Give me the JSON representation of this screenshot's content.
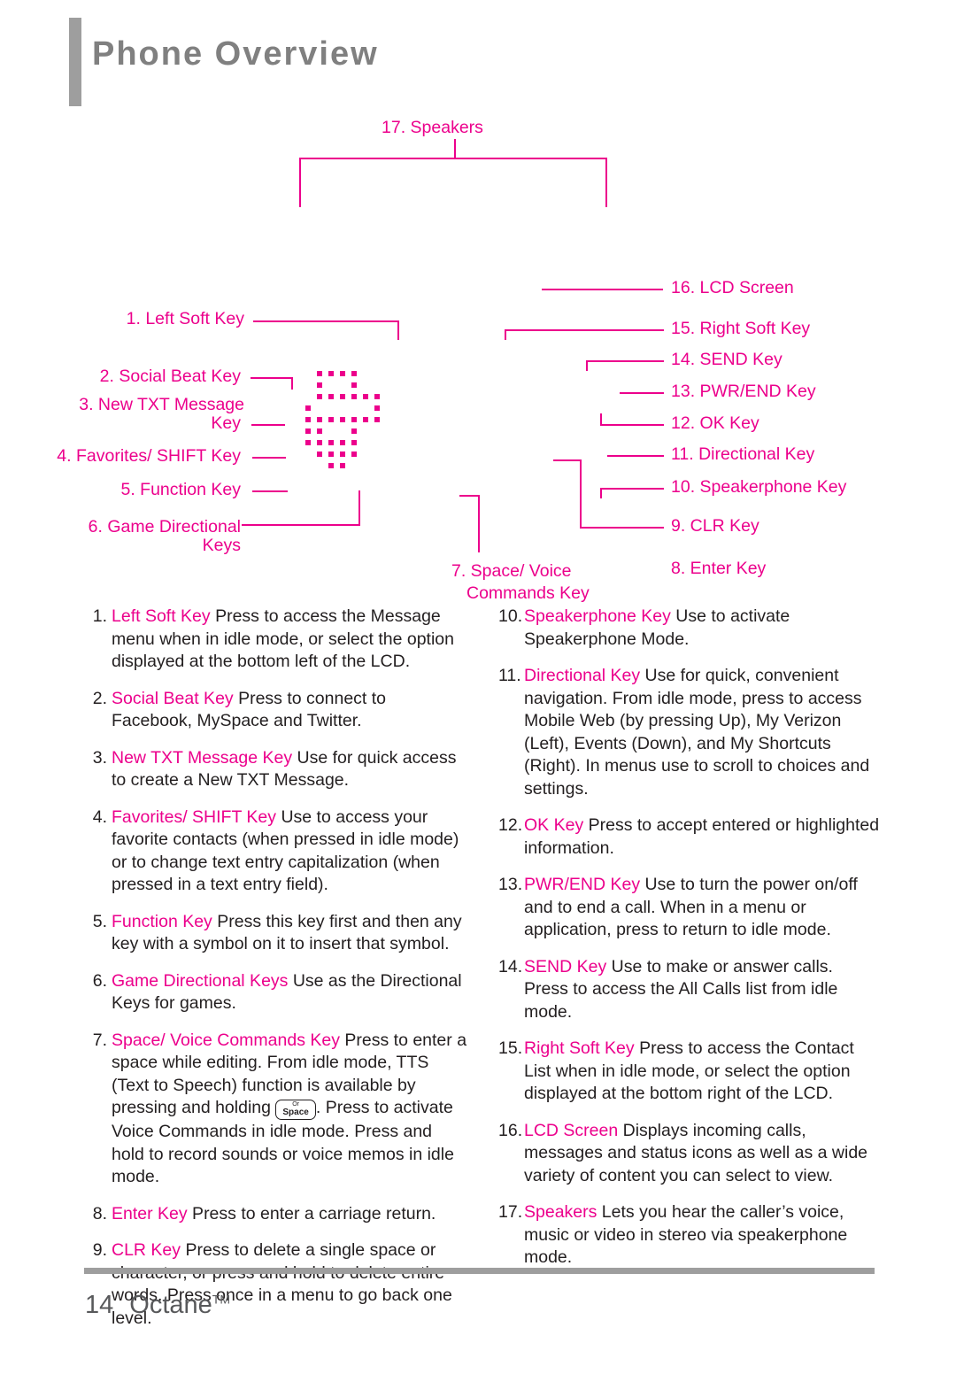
{
  "header": {
    "title": "Phone Overview"
  },
  "diagram": {
    "callouts": [
      {
        "id": "17",
        "label": "17. Speakers"
      },
      {
        "id": "16",
        "label": "16. LCD Screen"
      },
      {
        "id": "15",
        "label": "15. Right Soft Key"
      },
      {
        "id": "14",
        "label": "14. SEND Key"
      },
      {
        "id": "13",
        "label": "13. PWR/END Key"
      },
      {
        "id": "12",
        "label": "12. OK Key"
      },
      {
        "id": "11",
        "label": "11. Directional Key"
      },
      {
        "id": "10",
        "label": "10. Speakerphone Key"
      },
      {
        "id": "9",
        "label": "9. CLR Key"
      },
      {
        "id": "8",
        "label": "8. Enter Key"
      },
      {
        "id": "7a",
        "label": "7. Space/ Voice"
      },
      {
        "id": "7b",
        "label": "Commands Key"
      },
      {
        "id": "1",
        "label": "1. Left Soft Key"
      },
      {
        "id": "2",
        "label": "2. Social Beat Key"
      },
      {
        "id": "3a",
        "label": "3. New TXT Message"
      },
      {
        "id": "3b",
        "label": "Key"
      },
      {
        "id": "4",
        "label": "4. Favorites/ SHIFT Key"
      },
      {
        "id": "5",
        "label": "5. Function Key"
      },
      {
        "id": "6a",
        "label": "6. Game Directional"
      },
      {
        "id": "6b",
        "label": "Keys"
      }
    ]
  },
  "left_column": [
    {
      "num": "1.",
      "term": "Left Soft Key",
      "text": " Press to access the Message menu when in idle mode, or select the option displayed at the bottom left of the LCD."
    },
    {
      "num": "2.",
      "term": "Social Beat Key",
      "text": " Press to connect to Facebook, MySpace and Twitter."
    },
    {
      "num": "3.",
      "term": "New TXT Message Key",
      "text": "  Use for quick access to create a New TXT Message."
    },
    {
      "num": "4.",
      "term": "Favorites/ SHIFT Key",
      "text": " Use to access your favorite contacts (when pressed in idle mode) or to change text entry capitalization (when pressed in a text entry field)."
    },
    {
      "num": "5.",
      "term": "Function Key",
      "text": " Press this key first and then any key with a symbol on it to insert that symbol."
    },
    {
      "num": "6.",
      "term": "Game Directional Keys",
      "text": " Use as the Directional Keys for games."
    },
    {
      "num": "7.",
      "term": "Space/ Voice Commands Key",
      "text_before": " Press to enter a space while editing. From idle mode, TTS (Text to Speech) function is available by pressing and holding ",
      "glyph_top": "Or",
      "glyph_main": "Space",
      "text_after": ". Press to activate Voice Commands in idle mode. Press and hold to record sounds or voice memos in idle mode."
    },
    {
      "num": "8.",
      "term": "Enter Key",
      "text": " Press to enter a carriage return."
    },
    {
      "num": "9.",
      "term": "CLR Key",
      "text": " Press to delete a single space or character, or press and hold to delete entire words. Press once in a menu to go back one level."
    }
  ],
  "right_column": [
    {
      "num": "10.",
      "term": "Speakerphone Key",
      "text": " Use to activate Speakerphone Mode."
    },
    {
      "num": "11.",
      "term": "Directional Key",
      "text": " Use for quick, convenient navigation. From idle mode, press to access Mobile Web (by pressing Up), My Verizon (Left), Events (Down), and My Shortcuts (Right). In menus use to scroll to choices and settings."
    },
    {
      "num": "12.",
      "term": "OK Key",
      "text": " Press to accept entered or highlighted information."
    },
    {
      "num": "13.",
      "term": "PWR/END Key",
      "text": " Use to turn the power on/off and to end a call. When in a menu or application, press to return to idle mode."
    },
    {
      "num": "14.",
      "term": "SEND Key",
      "text": " Use to make or answer calls. Press to access the All Calls list from idle mode."
    },
    {
      "num": "15.",
      "term": "Right Soft Key",
      "text": " Press to access the Contact List when in idle mode, or select the option displayed at the bottom right of the LCD."
    },
    {
      "num": "16.",
      "term": "LCD Screen",
      "text": " Displays incoming calls, messages and status icons as well as a wide variety of content you can select to view."
    },
    {
      "num": "17.",
      "term": "Speakers",
      "text": " Lets you hear the caller’s voice, music or video in stereo via speakerphone mode."
    }
  ],
  "footer": {
    "page": "14",
    "product": "Octane",
    "trademark": "TM"
  },
  "colors": {
    "accent": "#ec008c",
    "title_gray": "#808080",
    "body": "#231f20"
  }
}
